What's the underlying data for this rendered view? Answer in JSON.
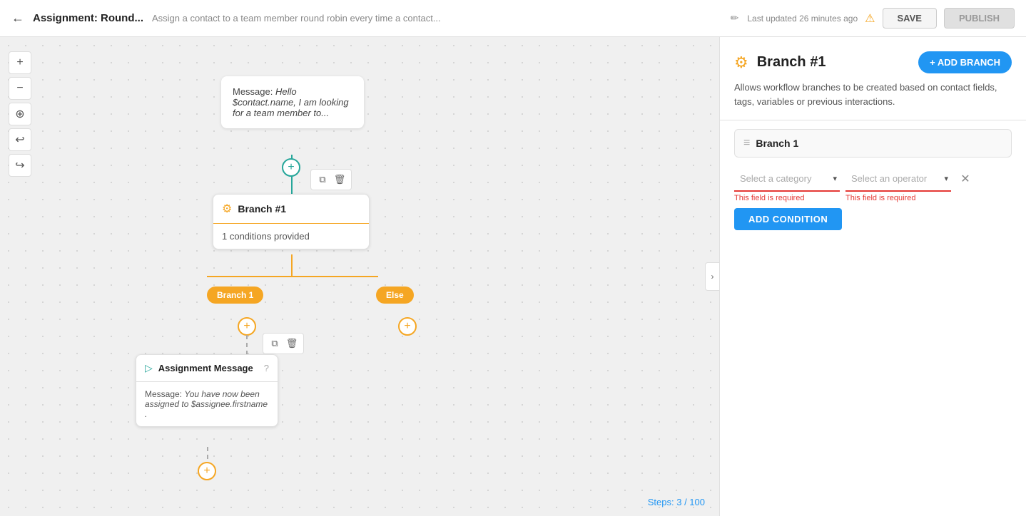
{
  "header": {
    "back_icon": "←",
    "title": "Assignment: Round...",
    "subtitle": "Assign a contact to a team member round robin every time a contact...",
    "edit_icon": "✏",
    "last_updated": "Last updated 26 minutes ago",
    "warning_icon": "⚠",
    "save_label": "SAVE",
    "publish_label": "PUBLISH"
  },
  "canvas": {
    "zoom_in": "+",
    "zoom_out": "−",
    "target_icon": "⊕",
    "undo_icon": "↩",
    "redo_icon": "↪",
    "collapse_icon": "›",
    "steps_label": "Steps:",
    "steps_current": "3",
    "steps_max": "100"
  },
  "nodes": {
    "message_top": {
      "text": "Message: ",
      "italic": "Hello $contact.name, I am looking for a team member to..."
    },
    "branch": {
      "icon": "⚙",
      "title": "Branch #1",
      "body": "1 conditions provided"
    },
    "branch1_label": "Branch 1",
    "else_label": "Else",
    "assignment": {
      "icon": "▷",
      "title": "Assignment Message",
      "help_icon": "?",
      "body_label": "Message: ",
      "body_italic": "You have now been assigned to $assignee.firstname ."
    }
  },
  "right_panel": {
    "icon": "⚙",
    "title": "Branch #1",
    "add_branch_label": "+ ADD BRANCH",
    "description": "Allows workflow branches to be created based on contact fields, tags, variables or previous interactions.",
    "branch_section": {
      "icon": "≡",
      "name": "Branch 1"
    },
    "condition": {
      "category_placeholder": "Select a category",
      "category_arrow": "▾",
      "category_error": "This field is required",
      "operator_placeholder": "Select an operator",
      "operator_arrow": "▾",
      "operator_error": "This field is required",
      "close_icon": "✕"
    },
    "add_condition_label": "ADD CONDITION"
  }
}
